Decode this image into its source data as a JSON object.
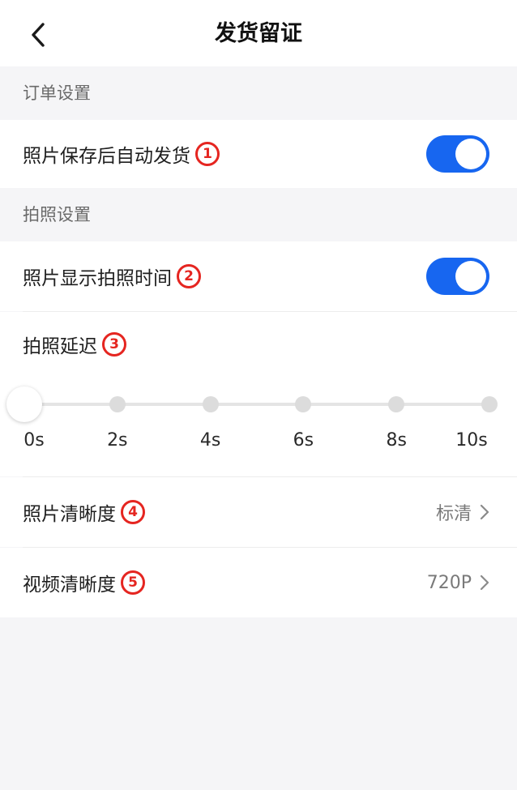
{
  "header": {
    "title": "发货留证",
    "back_icon": "chevron-left-icon"
  },
  "order_settings": {
    "section_title": "订单设置",
    "auto_ship": {
      "label": "照片保存后自动发货",
      "badge": "1",
      "enabled": true
    }
  },
  "photo_settings": {
    "section_title": "拍照设置",
    "show_time": {
      "label": "照片显示拍照时间",
      "badge": "2",
      "enabled": true
    },
    "delay": {
      "label": "拍照延迟",
      "badge": "3",
      "options": [
        "0s",
        "2s",
        "4s",
        "6s",
        "8s",
        "10s"
      ],
      "selected_index": 0
    },
    "photo_quality": {
      "label": "照片清晰度",
      "badge": "4",
      "value": "标清"
    },
    "video_quality": {
      "label": "视频清晰度",
      "badge": "5",
      "value": "720P"
    }
  },
  "colors": {
    "accent": "#1766f0",
    "badge": "#e52520",
    "background": "#f5f5f7"
  }
}
